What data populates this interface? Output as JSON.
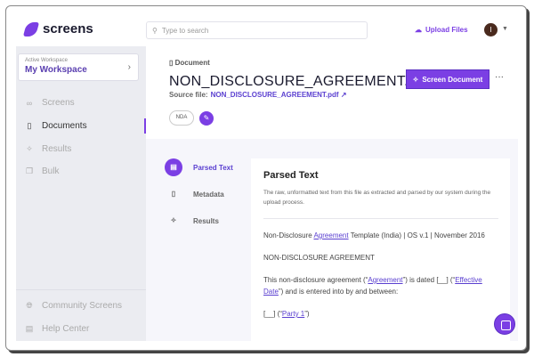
{
  "header": {
    "brand": "screens",
    "search_placeholder": "Type to search",
    "upload_label": "Upload Files",
    "avatar_initial": "I"
  },
  "sidebar": {
    "workspace_label": "Active Workspace",
    "workspace_name": "My Workspace",
    "items": [
      {
        "label": "Screens"
      },
      {
        "label": "Documents"
      },
      {
        "label": "Results"
      },
      {
        "label": "Bulk"
      }
    ],
    "footer": [
      {
        "label": "Community Screens"
      },
      {
        "label": "Help Center"
      }
    ]
  },
  "document": {
    "breadcrumb": "Document",
    "title": "NON_DISCLOSURE_AGREEMENT...",
    "source_label": "Source file:",
    "source_file": "NON_DISCLOSURE_AGREEMENT.pdf",
    "screen_button": "Screen Document",
    "more": "···",
    "tag": "NDA"
  },
  "tabs": [
    {
      "label": "Parsed Text"
    },
    {
      "label": "Metadata"
    },
    {
      "label": "Results"
    }
  ],
  "panel": {
    "title": "Parsed Text",
    "description": "The raw, unformatted text from this file as extracted and parsed by our system during the upload process.",
    "p1a": "Non-Disclosure ",
    "p1link": "Agreement",
    "p1b": " Template (India) | OS v.1 | November 2016",
    "p2": "NON-DISCLOSURE AGREEMENT",
    "p3a": "This non-disclosure agreement (“",
    "p3link1": "Agreement",
    "p3b": "”) is dated [__] (“",
    "p3link2": "Effective Date",
    "p3c": "”) and is entered into by and between:",
    "p4a": "[__] (“",
    "p4link": "Party 1",
    "p4b": "”)"
  },
  "colors": {
    "accent": "#7b3fe4"
  }
}
